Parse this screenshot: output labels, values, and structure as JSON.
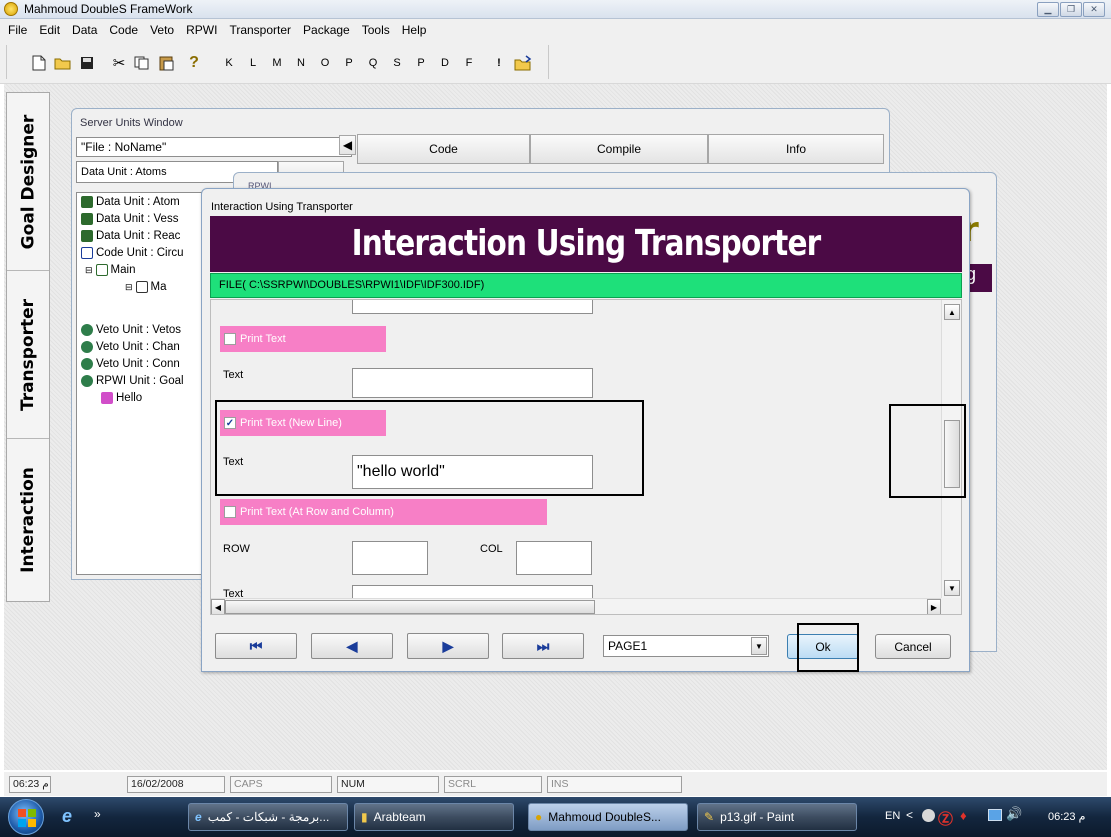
{
  "window": {
    "title": "Mahmoud DoubleS FrameWork"
  },
  "menu": [
    "File",
    "Edit",
    "Data",
    "Code",
    "Veto",
    "RPWI",
    "Transporter",
    "Package",
    "Tools",
    "Help"
  ],
  "toolbar": {
    "letters": [
      "K",
      "L",
      "M",
      "N",
      "O",
      "P",
      "Q",
      "S",
      "P",
      "D",
      "F",
      "!"
    ]
  },
  "side_tabs": [
    "Goal Designer",
    "Transporter",
    "Interaction"
  ],
  "server_units": {
    "title": "Server Units Window",
    "file_field": "\"File : NoName\"",
    "data_unit_field": "Data Unit : Atoms",
    "tabs": [
      "Code",
      "Compile",
      "Info"
    ],
    "tree": [
      {
        "label": "Data Unit : Atom",
        "icon": "data-unit-icon"
      },
      {
        "label": "Data Unit : Vess",
        "icon": "data-unit-icon"
      },
      {
        "label": "Data Unit : Reac",
        "icon": "data-unit-icon"
      },
      {
        "label": "Code Unit : Circu",
        "icon": "code-unit-icon"
      },
      {
        "label": "Main",
        "icon": "grid-icon"
      },
      {
        "label": "Ma",
        "icon": "document-icon"
      },
      {
        "label": "Veto Unit : Vetos",
        "icon": "globe-icon"
      },
      {
        "label": "Veto Unit : Chan",
        "icon": "globe-icon"
      },
      {
        "label": "Veto Unit : Conn",
        "icon": "globe-icon"
      },
      {
        "label": "RPWI Unit : Goal",
        "icon": "globe-icon"
      },
      {
        "label": "Hello",
        "icon": "hello-icon"
      }
    ]
  },
  "rpwi_window": {
    "title": "RPWI",
    "right_char": "r",
    "right_char2": "g"
  },
  "dialog": {
    "title": "Interaction Using Transporter",
    "banner": "Interaction Using Transporter",
    "file_path": "FILE( C:\\SSRPWI\\DOUBLES\\RPWI1\\IDF\\IDF300.IDF)",
    "sections": {
      "print_text": {
        "label": "Print Text",
        "checked": false,
        "text_label": "Text",
        "value": ""
      },
      "print_text_newline": {
        "label": "Print Text (New Line)",
        "checked": true,
        "text_label": "Text",
        "value": "\"hello world\""
      },
      "print_text_rowcol": {
        "label": "Print Text (At Row and Column)",
        "checked": false,
        "row_label": "ROW",
        "col_label": "COL",
        "text_label": "Text"
      }
    },
    "page_select": "PAGE1",
    "ok": "Ok",
    "cancel": "Cancel"
  },
  "statusbar": {
    "time": "06:23 م",
    "date": "16/02/2008",
    "caps": "CAPS",
    "num": "NUM",
    "scrl": "SCRL",
    "ins": "INS"
  },
  "taskbar": {
    "items": [
      "برمجة - شبكات - كمب...",
      "Arabteam",
      "Mahmoud DoubleS...",
      "p13.gif - Paint"
    ],
    "lang": "EN",
    "clock": "06:23 م"
  },
  "colors": {
    "banner": "#4b0a45",
    "file_bar": "#1ee07a",
    "pink": "#f77fc6"
  }
}
